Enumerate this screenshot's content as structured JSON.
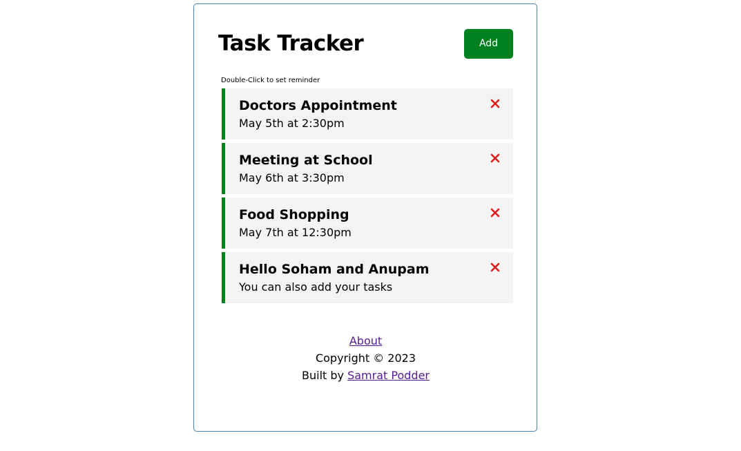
{
  "header": {
    "title": "Task Tracker",
    "add_button_label": "Add"
  },
  "hint": "Double-Click to set reminder",
  "tasks": [
    {
      "text": "Doctors Appointment",
      "day": "May 5th at 2:30pm",
      "reminder": true
    },
    {
      "text": "Meeting at School",
      "day": "May 6th at 3:30pm",
      "reminder": true
    },
    {
      "text": "Food Shopping",
      "day": "May 7th at 12:30pm",
      "reminder": true
    },
    {
      "text": "Hello Soham and Anupam",
      "day": "You can also add your tasks",
      "reminder": true
    }
  ],
  "footer": {
    "about_link": "About",
    "copyright": "Copyright © 2023",
    "built_by_prefix": "Built by",
    "author_link": "Samrat Podder"
  },
  "colors": {
    "accent": "#00801f",
    "delete": "#e01b1b",
    "task_bg": "#f4f4f4",
    "border": "steelblue"
  },
  "icons": {
    "delete": "close-icon"
  }
}
